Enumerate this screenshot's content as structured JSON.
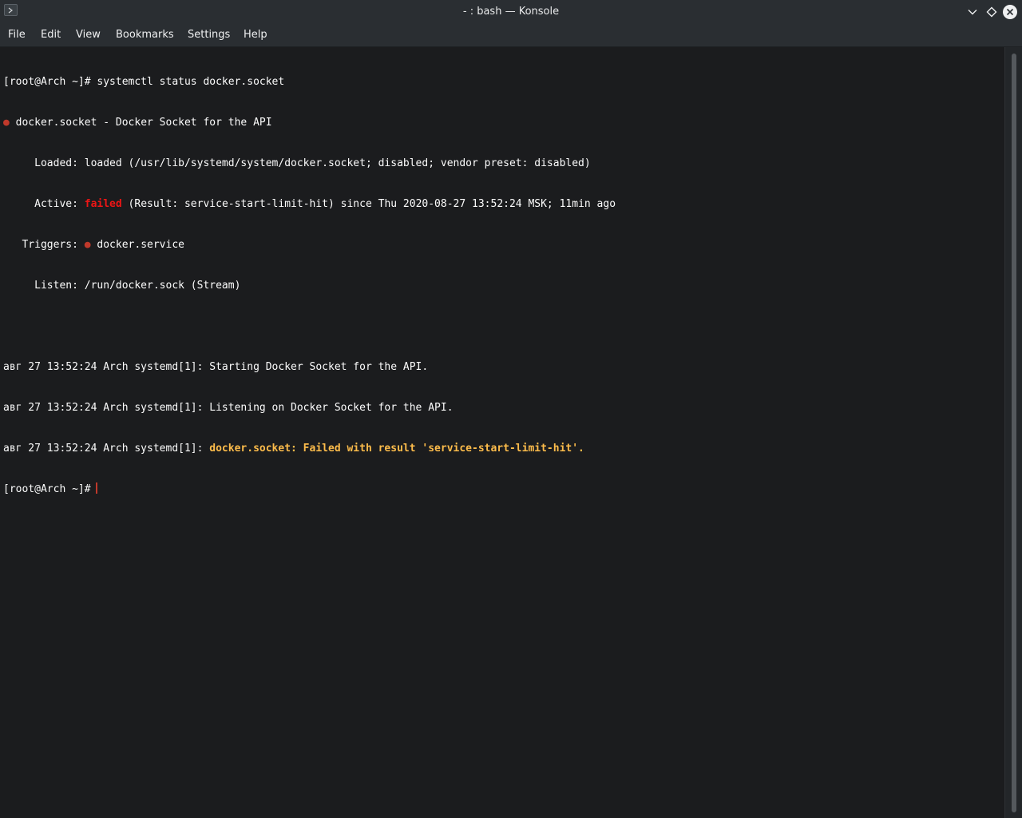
{
  "window": {
    "title": "- : bash — Konsole"
  },
  "menu": {
    "items": [
      "File",
      "Edit",
      "View",
      "Bookmarks",
      "Settings",
      "Help"
    ]
  },
  "terminal": {
    "line1": "[root@Arch ~]# systemctl status docker.socket",
    "line2_dot": "●",
    "line2_text": " docker.socket - Docker Socket for the API",
    "line3": "     Loaded: loaded (/usr/lib/systemd/system/docker.socket; disabled; vendor preset: disabled)",
    "line4_pre": "     Active: ",
    "line4_status": "failed",
    "line4_post": " (Result: service-start-limit-hit) since Thu 2020-08-27 13:52:24 MSK; 11min ago",
    "line5_pre": "   Triggers: ",
    "line5_dot": "●",
    "line5_post": " docker.service",
    "line6": "     Listen: /run/docker.sock (Stream)",
    "line8": "авг 27 13:52:24 Arch systemd[1]: Starting Docker Socket for the API.",
    "line9": "авг 27 13:52:24 Arch systemd[1]: Listening on Docker Socket for the API.",
    "line10_pre": "авг 27 13:52:24 Arch systemd[1]: ",
    "line10_msg": "docker.socket: Failed with result 'service-start-limit-hit'.",
    "prompt": "[root@Arch ~]#"
  },
  "colors": {
    "background": "#1b1c1e",
    "failed": "#ed1515",
    "warning": "#fdbc4b",
    "cursor": "#c0392b"
  },
  "icons": {
    "app": "terminal-icon",
    "minimize": "chevron-down-icon",
    "maximize": "diamond-icon",
    "close": "close-icon"
  }
}
